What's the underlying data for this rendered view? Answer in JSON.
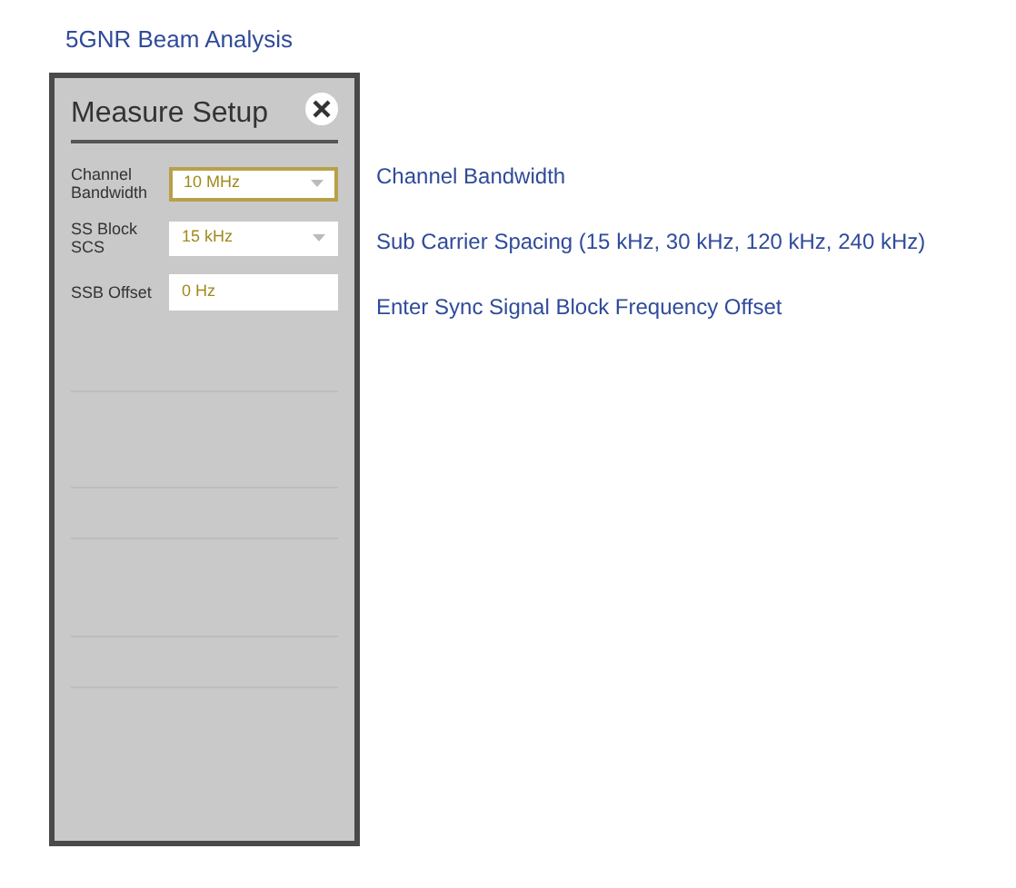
{
  "page_title": "5GNR Beam Analysis",
  "panel": {
    "title": "Measure Setup",
    "fields": [
      {
        "kind": "dropdown",
        "label": "Channel Bandwidth",
        "value": "10 MHz",
        "selected": true
      },
      {
        "kind": "dropdown",
        "label": "SS Block SCS",
        "value": "15 kHz",
        "selected": false
      },
      {
        "kind": "input",
        "label": "SSB Offset",
        "value": "0 Hz",
        "selected": false
      }
    ]
  },
  "annotations": [
    "Channel Bandwidth",
    "Sub Carrier Spacing (15 kHz, 30 kHz, 120 kHz, 240 kHz)",
    "Enter Sync Signal Block Frequency Offset"
  ]
}
